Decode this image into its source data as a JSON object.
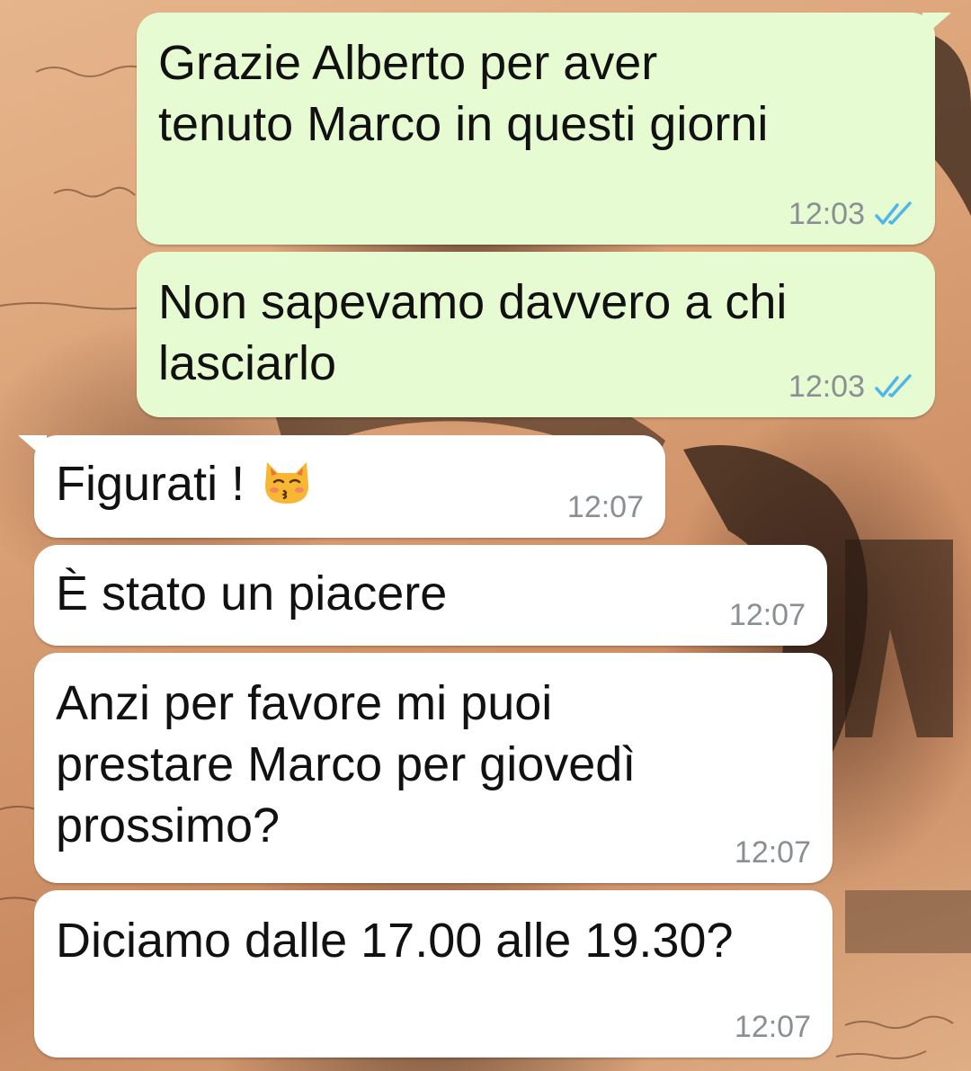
{
  "messages": [
    {
      "direction": "outgoing",
      "text": "Grazie Alberto per aver\ntenuto Marco in questi giorni",
      "time": "12:03",
      "status": "read"
    },
    {
      "direction": "outgoing",
      "text": "Non sapevamo davvero a chi\nlasciarlo",
      "time": "12:03",
      "status": "read"
    },
    {
      "direction": "incoming",
      "text": "Figurati ! ",
      "emoji": "😚",
      "emoji_icon": "kissing-cat-emoji",
      "time": "12:07"
    },
    {
      "direction": "incoming",
      "text": "È stato un piacere",
      "time": "12:07"
    },
    {
      "direction": "incoming",
      "text": "Anzi per favore mi puoi\nprestare Marco per giovedì\nprossimo?",
      "time": "12:07"
    },
    {
      "direction": "incoming",
      "text": "Diciamo dalle 17.00 alle 19.30?",
      "time": "12:07"
    }
  ],
  "colors": {
    "outgoing_bubble": "#e6fbd2",
    "incoming_bubble": "#ffffff",
    "timestamp": "#8a8f93",
    "read_tick": "#4fb6ec"
  },
  "icons": {
    "read_status": "double-check-icon"
  }
}
